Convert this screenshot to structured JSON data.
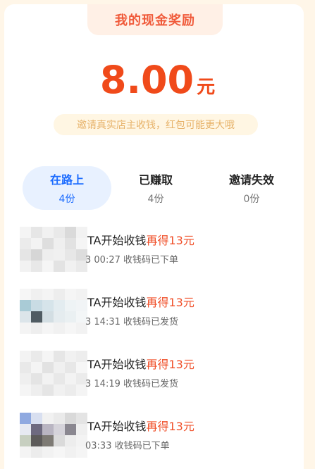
{
  "header": {
    "title": "我的现金奖励"
  },
  "amount": {
    "value": "8.00",
    "unit": "元"
  },
  "hint": "邀请真实店主收钱，红包可能更大哦",
  "tabs": [
    {
      "label": "在路上",
      "count": "4份"
    },
    {
      "label": "已赚取",
      "count": "4份"
    },
    {
      "label": "邀请失效",
      "count": "0份"
    }
  ],
  "list": [
    {
      "title_prefix": "TA开始收钱",
      "title_reward": "再得13元",
      "subtitle": "3 00:27 收钱码已下单"
    },
    {
      "title_prefix": "TA开始收钱",
      "title_reward": "再得13元",
      "subtitle": "3 14:31 收钱码已发货"
    },
    {
      "title_prefix": "TA开始收钱",
      "title_reward": "再得13元",
      "subtitle": "3 14:19 收钱码已发货"
    },
    {
      "title_prefix": "TA开始收钱",
      "title_reward": "再得13元",
      "subtitle": "03:33 收钱码已下单"
    }
  ],
  "colors": {
    "accent": "#F04A1A",
    "active_tab": "#1C6CFF",
    "active_tab_bg": "#E8F1FF",
    "page_bg": "#FFF6E8"
  }
}
